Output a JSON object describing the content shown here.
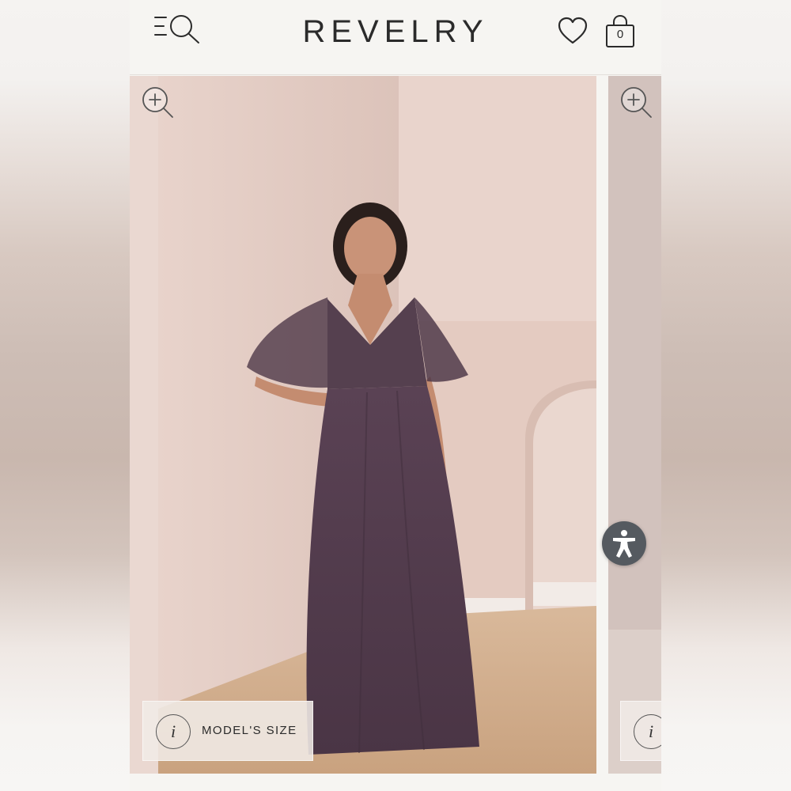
{
  "header": {
    "logo": "REVELRY",
    "cart_count": "0",
    "menu_icon": "menu-search-icon",
    "wishlist_icon": "heart-icon",
    "cart_icon": "shopping-bag-icon"
  },
  "gallery": {
    "zoom_icon": "zoom-in-icon",
    "model_size_label": "MODEL'S SIZE",
    "info_glyph": "i",
    "product_color": "#4f3a4b",
    "wall_color": "#e2cdc5"
  },
  "accessibility": {
    "icon": "accessibility-icon",
    "color": "#555a60"
  }
}
